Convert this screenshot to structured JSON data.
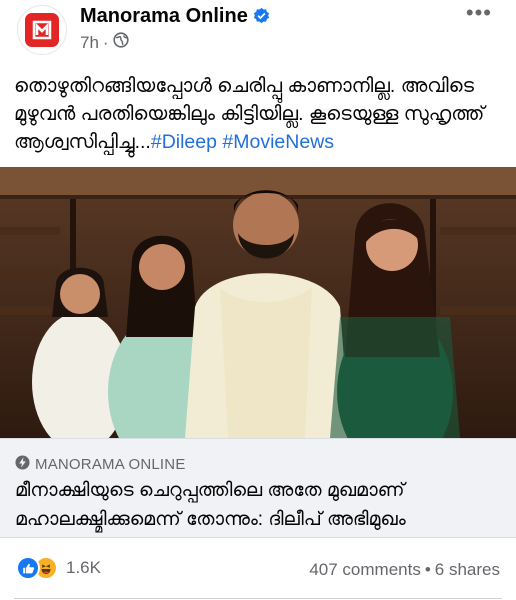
{
  "post": {
    "page_name": "Manorama Online",
    "time": "7h",
    "caption": "തൊഴുതിറങ്ങിയപ്പോൾ ചെരിപ്പു കാണാനില്ല. അവിടെ മുഴുവൻ പരതിയെങ്കിലും കിട്ടിയില്ല.  കൂടെയുള്ള സുഹൃത്ത് ആശ്വസിപ്പിച്ചു...",
    "hashtags": [
      "#Dileep",
      "#MovieNews"
    ],
    "more_icon": "more-horizontal-icon",
    "verified_icon": "verified-badge-icon",
    "privacy_icon": "globe-icon"
  },
  "link_preview": {
    "source": "MANORAMA ONLINE",
    "title": "മീനാക്ഷിയുടെ ചെറുപ്പത്തിലെ അതേ മുഖമാണ് മഹാലക്ഷ്മിക്കുമെന്ന് തോന്നും: ദിലീപ് അഭിമുഖം"
  },
  "engagement": {
    "reaction_count": "1.6K",
    "comments": "407 comments",
    "shares": "6 shares",
    "separator": "•"
  },
  "colors": {
    "brand_red": "#e32526",
    "link_blue": "#216fdb",
    "secondary_text": "#65676b",
    "preview_bg": "#f0f2f5"
  }
}
